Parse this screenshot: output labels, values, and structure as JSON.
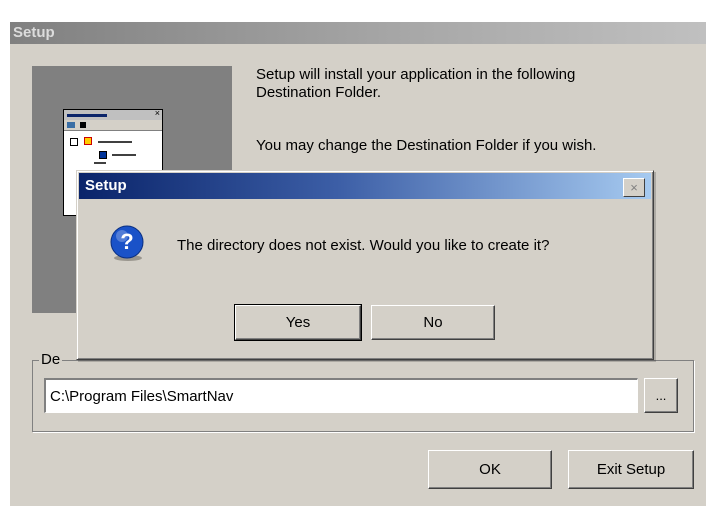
{
  "main_window": {
    "title": "Setup",
    "description_line1": "Setup will install your application in the following",
    "description_line2": "Destination Folder.",
    "description_line3": "You may change the Destination Folder if you wish.",
    "group_label": "De",
    "path_value": "C:\\Program Files\\SmartNav",
    "browse_label": "...",
    "ok_label": "OK",
    "exit_label": "Exit Setup"
  },
  "dialog": {
    "title": "Setup",
    "close_glyph": "×",
    "message": "The directory does not exist. Would you like to create it?",
    "icon": "question-icon",
    "yes_label": "Yes",
    "no_label": "No"
  },
  "colors": {
    "window_bg": "#d4d0c8",
    "active_title_start": "#0a246a",
    "active_title_end": "#a6caf0",
    "inactive_title": "#808080",
    "icon_blue": "#1a52c8"
  }
}
